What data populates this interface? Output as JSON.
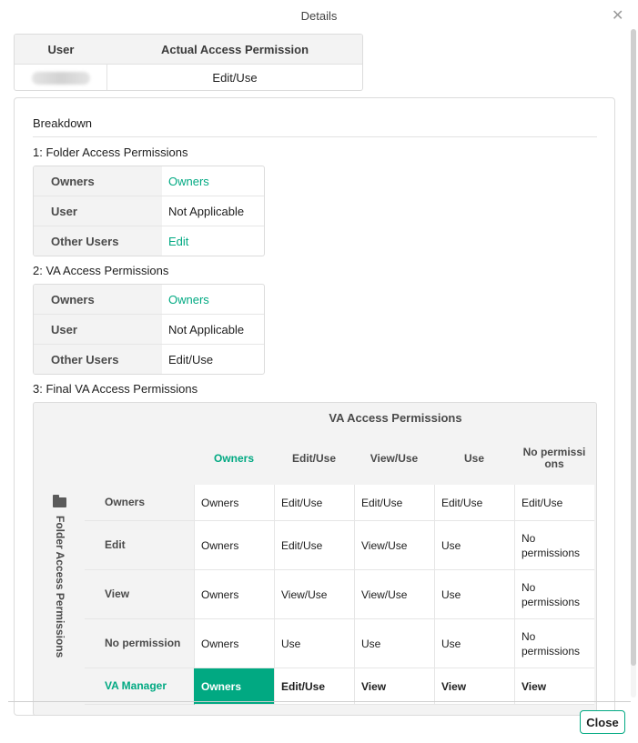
{
  "dialog": {
    "title": "Details",
    "close_label": "Close"
  },
  "summary": {
    "headers": [
      "User",
      "Actual Access Permission"
    ],
    "actual_permission": "Edit/Use"
  },
  "breakdown": {
    "title": "Breakdown",
    "folder_section": {
      "title": "1: Folder Access Permissions",
      "rows": [
        {
          "label": "Owners",
          "value": "Owners"
        },
        {
          "label": "User",
          "value": "Not Applicable"
        },
        {
          "label": "Other Users",
          "value": "Edit"
        }
      ]
    },
    "va_section": {
      "title": "2: VA Access Permissions",
      "rows": [
        {
          "label": "Owners",
          "value": "Owners"
        },
        {
          "label": "User",
          "value": "Not Applicable"
        },
        {
          "label": "Other Users",
          "value": "Edit/Use"
        }
      ]
    },
    "final_section": {
      "title": "3: Final VA Access Permissions",
      "group_header": "VA Access Permissions",
      "side_header": "Folder Access Permissions",
      "columns": [
        "Owners",
        "Edit/Use",
        "View/Use",
        "Use",
        "No permissions"
      ],
      "rows": [
        {
          "label": "Owners",
          "cells": [
            "Owners",
            "Edit/Use",
            "Edit/Use",
            "Edit/Use",
            "Edit/Use"
          ]
        },
        {
          "label": "Edit",
          "cells": [
            "Owners",
            "Edit/Use",
            "View/Use",
            "Use",
            "No permissions"
          ]
        },
        {
          "label": "View",
          "cells": [
            "Owners",
            "View/Use",
            "View/Use",
            "Use",
            "No permissions"
          ]
        },
        {
          "label": "No permission",
          "cells": [
            "Owners",
            "Use",
            "Use",
            "Use",
            "No permissions"
          ]
        },
        {
          "label": "VA Manager",
          "cells": [
            "Owners",
            "Edit/Use",
            "View",
            "View",
            "View"
          ]
        }
      ]
    }
  },
  "colors": {
    "accent": "#01a982",
    "header_bg": "#f3f3f3",
    "border": "#dcdcdc"
  }
}
